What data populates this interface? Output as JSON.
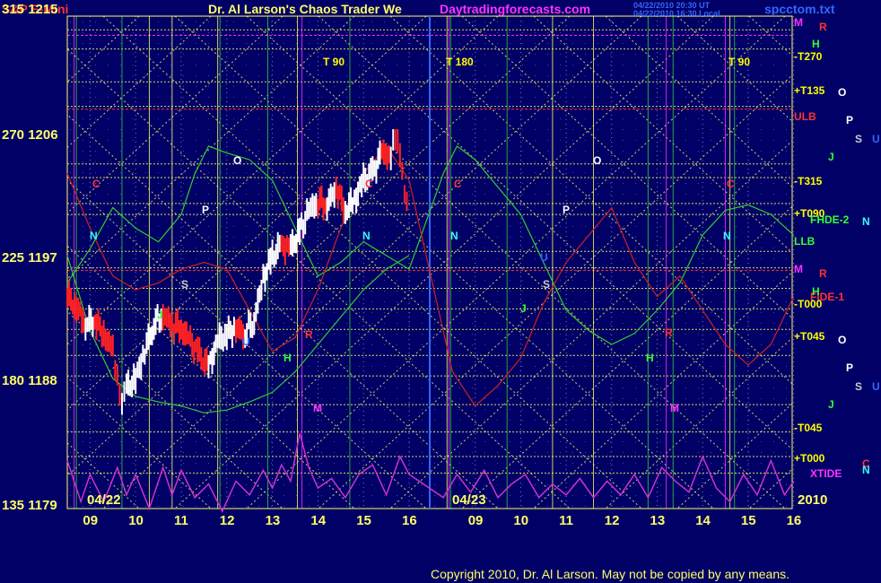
{
  "header": {
    "symbol": "S&P E-Mini",
    "title": "Dr. Al Larson's Chaos Trader We",
    "site": "Daytradingforecasts.com",
    "stamp1": "04/22/2010 20:30 UT",
    "stamp2": "04/22/2010 16:30 Local",
    "file": "spcctom.txt"
  },
  "y_labels": [
    {
      "angle": "315",
      "price": "1215"
    },
    {
      "angle": "270",
      "price": "1206"
    },
    {
      "angle": "225",
      "price": "1197"
    },
    {
      "angle": "180",
      "price": "1188"
    },
    {
      "angle": "135",
      "price": "1179"
    }
  ],
  "x_labels": [
    "09",
    "10",
    "11",
    "12",
    "13",
    "14",
    "15",
    "16",
    "09",
    "10",
    "11",
    "12",
    "13",
    "14",
    "15",
    "16"
  ],
  "date_labels": {
    "day1": "04/22",
    "day2": "04/23",
    "year": "2010"
  },
  "time_markers": [
    "T 90",
    "T 180",
    "T 90"
  ],
  "flux_labels": [
    {
      "text": "-T270",
      "color": "#ffff00"
    },
    {
      "text": "+T135",
      "color": "#ffff00"
    },
    {
      "text": "ULB",
      "color": "#ff3333"
    },
    {
      "text": "-T315",
      "color": "#ffff00"
    },
    {
      "text": "+T090",
      "color": "#ffff00"
    },
    {
      "text": "FHDE-2",
      "color": "#33ff33"
    },
    {
      "text": "LLB",
      "color": "#33ff33"
    },
    {
      "text": "FIDE-1",
      "color": "#ff3333"
    },
    {
      "text": "-T000",
      "color": "#ffff00"
    },
    {
      "text": "+T045",
      "color": "#ffff00"
    },
    {
      "text": "-T045",
      "color": "#ffff00"
    },
    {
      "text": "+T000",
      "color": "#ffff00"
    },
    {
      "text": "XTIDE",
      "color": "#ff33ff"
    }
  ],
  "planet_labels_right": [
    {
      "text": "M",
      "color": "#ff33ff"
    },
    {
      "text": "R",
      "color": "#ff3333"
    },
    {
      "text": "H",
      "color": "#33ff33"
    },
    {
      "text": "O",
      "color": "#ffffff"
    },
    {
      "text": "P",
      "color": "#ffffff"
    },
    {
      "text": "S",
      "color": "#cccccc"
    },
    {
      "text": "U",
      "color": "#3366ff"
    },
    {
      "text": "J",
      "color": "#33ff33"
    },
    {
      "text": "N",
      "color": "#33ffff"
    },
    {
      "text": "M",
      "color": "#ff33ff"
    },
    {
      "text": "R",
      "color": "#ff3333"
    },
    {
      "text": "H",
      "color": "#33ff33"
    },
    {
      "text": "O",
      "color": "#ffffff"
    },
    {
      "text": "P",
      "color": "#ffffff"
    },
    {
      "text": "S",
      "color": "#cccccc"
    },
    {
      "text": "U",
      "color": "#3366ff"
    },
    {
      "text": "J",
      "color": "#33ff33"
    },
    {
      "text": "C",
      "color": "#ff3333"
    },
    {
      "text": "N",
      "color": "#33ffff"
    }
  ],
  "planet_labels_in_chart": [
    {
      "text": "C",
      "color": "#ff3333"
    },
    {
      "text": "N",
      "color": "#33ffff"
    },
    {
      "text": "O",
      "color": "#ffffff"
    },
    {
      "text": "P",
      "color": "#ffffff"
    },
    {
      "text": "S",
      "color": "#cccccc"
    },
    {
      "text": "U",
      "color": "#3366ff"
    },
    {
      "text": "R",
      "color": "#ff3333"
    },
    {
      "text": "J",
      "color": "#33ff33"
    },
    {
      "text": "H",
      "color": "#33ff33"
    },
    {
      "text": "M",
      "color": "#ff33ff"
    },
    {
      "text": "C",
      "color": "#ff3333"
    },
    {
      "text": "N",
      "color": "#33ffff"
    },
    {
      "text": "C",
      "color": "#ff3333"
    },
    {
      "text": "N",
      "color": "#33ffff"
    },
    {
      "text": "O",
      "color": "#ffffff"
    },
    {
      "text": "P",
      "color": "#ffffff"
    },
    {
      "text": "U",
      "color": "#3366ff"
    },
    {
      "text": "S",
      "color": "#cccccc"
    },
    {
      "text": "J",
      "color": "#33ff33"
    },
    {
      "text": "R",
      "color": "#ff3333"
    },
    {
      "text": "H",
      "color": "#33ff33"
    },
    {
      "text": "M",
      "color": "#ff33ff"
    },
    {
      "text": "C",
      "color": "#ff3333"
    },
    {
      "text": "N",
      "color": "#33ffff"
    }
  ],
  "copyright": "Copyright 2010, Dr. Al Larson. May not be copied by any means.",
  "colors": {
    "background": "#000066",
    "grid": "#ffff66",
    "price_up": "#ffffff",
    "price_down": "#ff2222",
    "xtide": "#cc33cc",
    "green_flux": "#33cc33",
    "red_flux": "#cc2222"
  },
  "chart_data": {
    "type": "line",
    "ylim": [
      1179,
      1215
    ],
    "y_ticks": [
      1179,
      1188,
      1197,
      1206,
      1215
    ],
    "price_series": {
      "name": "",
      "x": [
        8.5,
        8.7,
        8.9,
        9.1,
        9.3,
        9.5,
        9.6,
        9.7,
        9.8,
        10.0,
        10.2,
        10.4,
        10.6,
        10.8,
        11.0,
        11.2,
        11.4,
        11.6,
        11.8,
        12.0,
        12.2,
        12.4,
        12.6,
        12.8,
        13.0,
        13.2,
        13.4,
        13.6,
        13.8,
        14.0,
        14.2,
        14.4,
        14.6,
        14.8,
        15.0,
        15.2,
        15.4,
        15.6,
        15.7,
        15.8,
        15.9,
        16.0
      ],
      "values": [
        1194.5,
        1193.8,
        1192.5,
        1192.8,
        1191.8,
        1190.5,
        1188.5,
        1186.5,
        1187.8,
        1188.5,
        1190.5,
        1192.5,
        1193.2,
        1192.5,
        1192.2,
        1191.2,
        1190.2,
        1189.3,
        1191.2,
        1191.8,
        1192.2,
        1191.8,
        1192.8,
        1195.8,
        1197.5,
        1198.2,
        1198.0,
        1199.2,
        1200.8,
        1201.5,
        1201.2,
        1202.5,
        1200.8,
        1201.5,
        1203.0,
        1203.5,
        1205.0,
        1204.8,
        1206.0,
        1205.2,
        1202.5,
        1200.5
      ]
    },
    "green_band_upper": {
      "x": [
        8.5,
        9.0,
        9.5,
        10.0,
        10.5,
        11.0,
        11.3,
        11.6,
        12.0,
        12.5,
        13.0,
        13.5,
        14.0,
        14.5,
        15.0,
        15.5,
        16.0,
        16.3,
        16.6,
        17.0,
        17.5,
        18.0,
        18.5,
        19.0,
        19.5,
        20.0,
        20.5,
        21.0,
        21.5,
        22.0,
        22.5,
        23.0,
        23.5,
        24.0
      ],
      "values": [
        1195.5,
        1198.0,
        1201.0,
        1199.5,
        1198.5,
        1200.5,
        1203.5,
        1205.5,
        1205.0,
        1204.5,
        1203.0,
        1199.5,
        1196.0,
        1197.0,
        1198.5,
        1197.5,
        1196.5,
        1203.5,
        1205.5,
        1204.5,
        1202.5,
        1200.5,
        1197.0,
        1193.5,
        1192.0,
        1191.0,
        1191.8,
        1193.5,
        1195.5,
        1199.0,
        1200.8,
        1201.2,
        1200.5,
        1199.0
      ]
    },
    "green_band_lower": {
      "x": [
        8.5,
        9.0,
        9.5,
        10.0,
        10.5,
        11.0,
        11.5,
        12.0,
        12.5,
        13.0,
        13.5,
        14.0,
        14.5,
        15.0,
        15.5,
        16.0
      ],
      "values": [
        1197.5,
        1192.0,
        1188.5,
        1187.2,
        1186.8,
        1186.5,
        1186.0,
        1186.2,
        1186.8,
        1187.5,
        1189.0,
        1191.0,
        1193.0,
        1195.0,
        1196.5,
        1197.5
      ]
    },
    "red_line": {
      "x": [
        8.5,
        9.0,
        9.5,
        10.0,
        10.5,
        11.0,
        11.5,
        12.0,
        12.5,
        13.0,
        13.5,
        14.0,
        14.5,
        15.0,
        15.5,
        16.0,
        16.5,
        17.0,
        17.5,
        18.0,
        18.5,
        19.0,
        19.5,
        20.0,
        20.5,
        21.0,
        21.5,
        22.0,
        22.5,
        23.0,
        23.5,
        24.0
      ],
      "values": [
        1203.5,
        1199.5,
        1196.0,
        1195.0,
        1195.5,
        1196.5,
        1197.0,
        1196.5,
        1193.5,
        1190.5,
        1191.5,
        1195.0,
        1199.5,
        1203.5,
        1205.5,
        1203.0,
        1189.0,
        1186.5,
        1188.0,
        1190.0,
        1194.0,
        1197.0,
        1199.0,
        1201.0,
        1197.0,
        1194.5,
        1196.0,
        1193.5,
        1191.0,
        1189.5,
        1191.0,
        1194.5
      ]
    },
    "xtide": {
      "x": [
        8.5,
        8.8,
        9.0,
        9.3,
        9.6,
        9.8,
        10.0,
        10.3,
        10.6,
        10.8,
        11.0,
        11.3,
        11.6,
        11.9,
        12.2,
        12.5,
        12.8,
        13.0,
        13.2,
        13.4,
        13.6,
        13.8,
        14.0,
        14.3,
        14.6,
        14.9,
        15.2,
        15.5,
        15.8,
        16.0,
        16.3,
        16.6,
        16.9,
        17.2,
        17.5,
        17.8,
        18.1,
        18.4,
        18.7,
        19.0,
        19.3,
        19.6,
        19.9,
        20.2,
        20.5,
        20.8,
        21.1,
        21.4,
        21.7,
        22.0,
        22.3,
        22.6,
        22.9,
        23.2,
        23.5,
        23.8,
        24.0
      ],
      "values": [
        1182.5,
        1179.5,
        1181.5,
        1179.5,
        1182.0,
        1180.0,
        1181.5,
        1179.0,
        1182.0,
        1180.0,
        1181.8,
        1179.8,
        1180.8,
        1178.8,
        1181.0,
        1180.0,
        1181.8,
        1180.5,
        1182.2,
        1181.0,
        1184.5,
        1182.0,
        1180.5,
        1181.2,
        1179.8,
        1181.5,
        1182.2,
        1180.0,
        1182.8,
        1181.5,
        1179.8,
        1181.5,
        1180.2,
        1181.8,
        1179.8,
        1180.8,
        1181.5,
        1179.8,
        1180.8,
        1180.0,
        1181.2,
        1179.8,
        1181.0,
        1180.0,
        1181.5,
        1179.8,
        1182.0,
        1181.0,
        1180.2,
        1182.8,
        1180.5,
        1179.5,
        1181.5,
        1180.0,
        1182.5,
        1180.0,
        1181.0
      ]
    }
  }
}
